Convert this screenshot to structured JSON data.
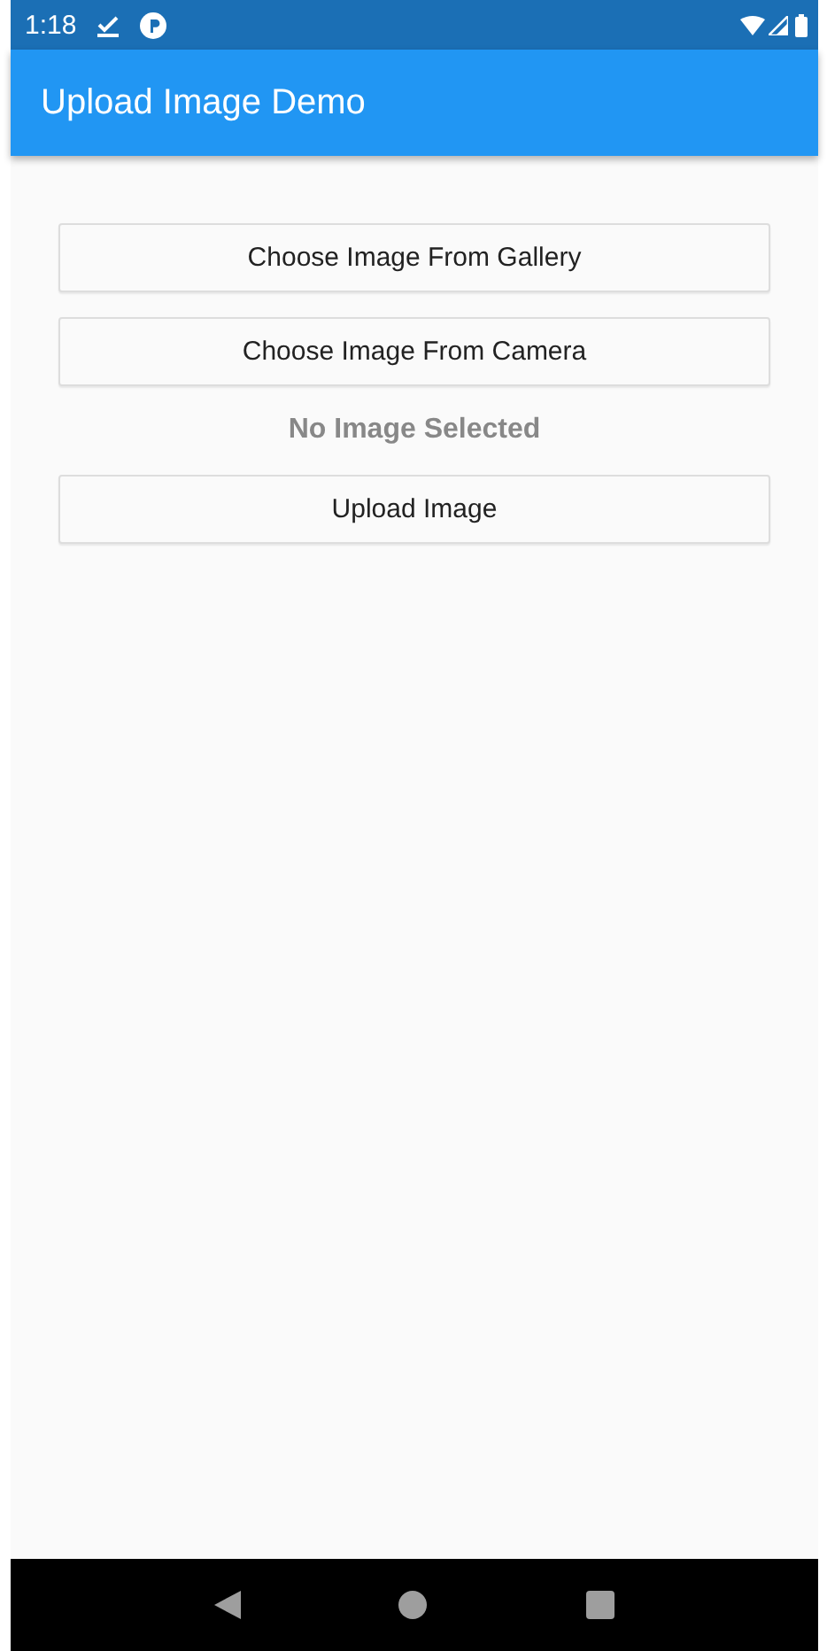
{
  "status_bar": {
    "time": "1:18"
  },
  "app_bar": {
    "title": "Upload Image Demo"
  },
  "content": [
    {
      "kind": "button",
      "label": "Choose Image From Gallery"
    },
    {
      "kind": "button",
      "label": "Choose Image From Camera"
    },
    {
      "kind": "status",
      "label": "No Image Selected"
    },
    {
      "kind": "button",
      "label": "Upload Image"
    }
  ]
}
